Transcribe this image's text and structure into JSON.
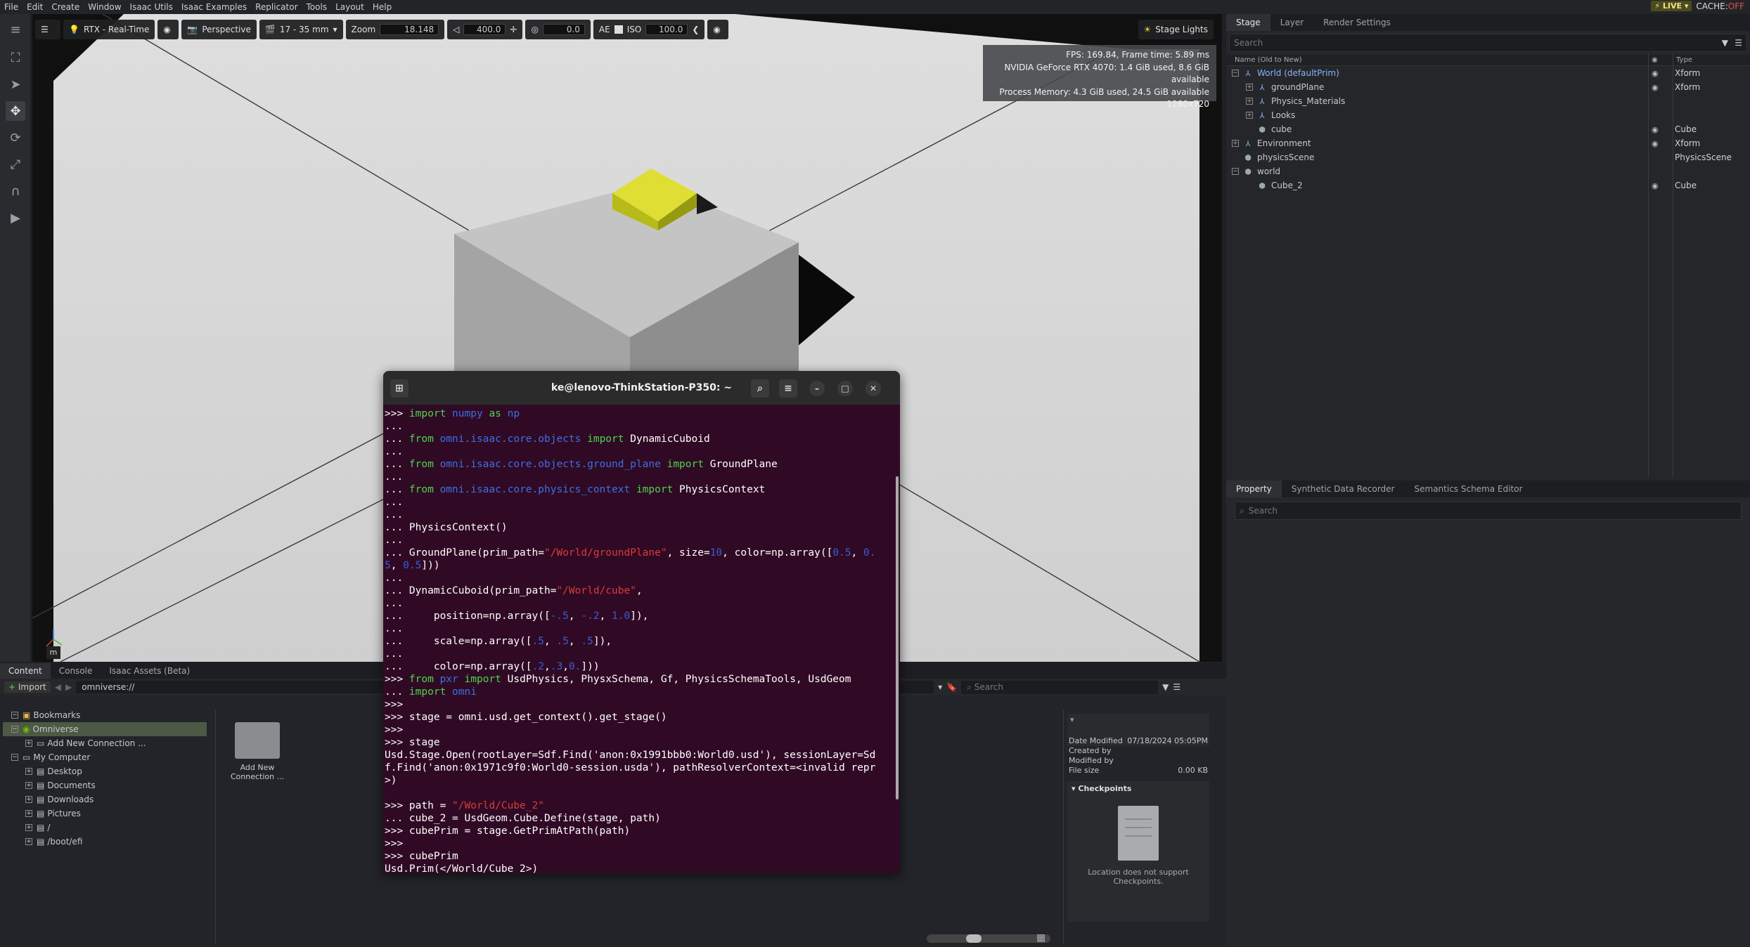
{
  "menubar": {
    "items": [
      "File",
      "Edit",
      "Create",
      "Window",
      "Isaac Utils",
      "Isaac Examples",
      "Replicator",
      "Tools",
      "Layout",
      "Help"
    ],
    "live_label": "LIVE",
    "cache_label": "CACHE:",
    "cache_state": "OFF"
  },
  "viewport_toolbar": {
    "renderer": "RTX - Real-Time",
    "camera": "Perspective",
    "lens": "17 - 35 mm",
    "zoom_label": "Zoom",
    "zoom_value": "18.148",
    "focus_value": "400.0",
    "fstop_value": "0.0",
    "ae_label": "AE",
    "iso_label": "ISO",
    "iso_value": "100.0",
    "stage_lights": "Stage Lights"
  },
  "stats": {
    "line1": "FPS: 169.84, Frame time: 5.89 ms",
    "line2": "NVIDIA GeForce RTX 4070: 1.4 GiB used, 8.6 GiB available",
    "line3": "Process Memory: 4.3 GiB used, 24.5 GiB available",
    "line4": "1280x720"
  },
  "axis_label": "m",
  "stage_panel": {
    "tabs": [
      "Stage",
      "Layer",
      "Render Settings"
    ],
    "search_placeholder": "Search",
    "col_name": "Name (Old to New)",
    "col_type": "Type",
    "tree": [
      {
        "name": "World (defaultPrim)",
        "type": "Xform"
      },
      {
        "name": "groundPlane",
        "type": "Xform"
      },
      {
        "name": "Physics_Materials",
        "type": ""
      },
      {
        "name": "Looks",
        "type": ""
      },
      {
        "name": "cube",
        "type": "Cube"
      },
      {
        "name": "Environment",
        "type": "Xform"
      },
      {
        "name": "physicsScene",
        "type": "PhysicsScene"
      },
      {
        "name": "world",
        "type": ""
      },
      {
        "name": "Cube_2",
        "type": "Cube"
      }
    ]
  },
  "property_panel": {
    "tabs": [
      "Property",
      "Synthetic Data Recorder",
      "Semantics Schema Editor"
    ],
    "search_placeholder": "Search"
  },
  "content_panel": {
    "tabs": [
      "Content",
      "Console",
      "Isaac Assets (Beta)"
    ],
    "import_label": "Import",
    "address": "omniverse://",
    "search_placeholder": "Search",
    "tree": [
      "Bookmarks",
      "Omniverse",
      "Add New Connection ...",
      "My Computer",
      "Desktop",
      "Documents",
      "Downloads",
      "Pictures",
      "/",
      "/boot/efi"
    ],
    "thumb_label_1": "Add New",
    "thumb_label_2": "Connection ...",
    "details": {
      "date_modified_label": "Date Modified",
      "date_modified": "07/18/2024 05:05PM",
      "created_by": "Created by",
      "modified_by": "Modified by",
      "file_size_label": "File size",
      "file_size": "0.00 KB",
      "checkpoints": "Checkpoints",
      "no_checkpoints_1": "Location does not support",
      "no_checkpoints_2": "Checkpoints."
    }
  },
  "terminal": {
    "title": "ke@lenovo-ThinkStation-P350: ~"
  }
}
